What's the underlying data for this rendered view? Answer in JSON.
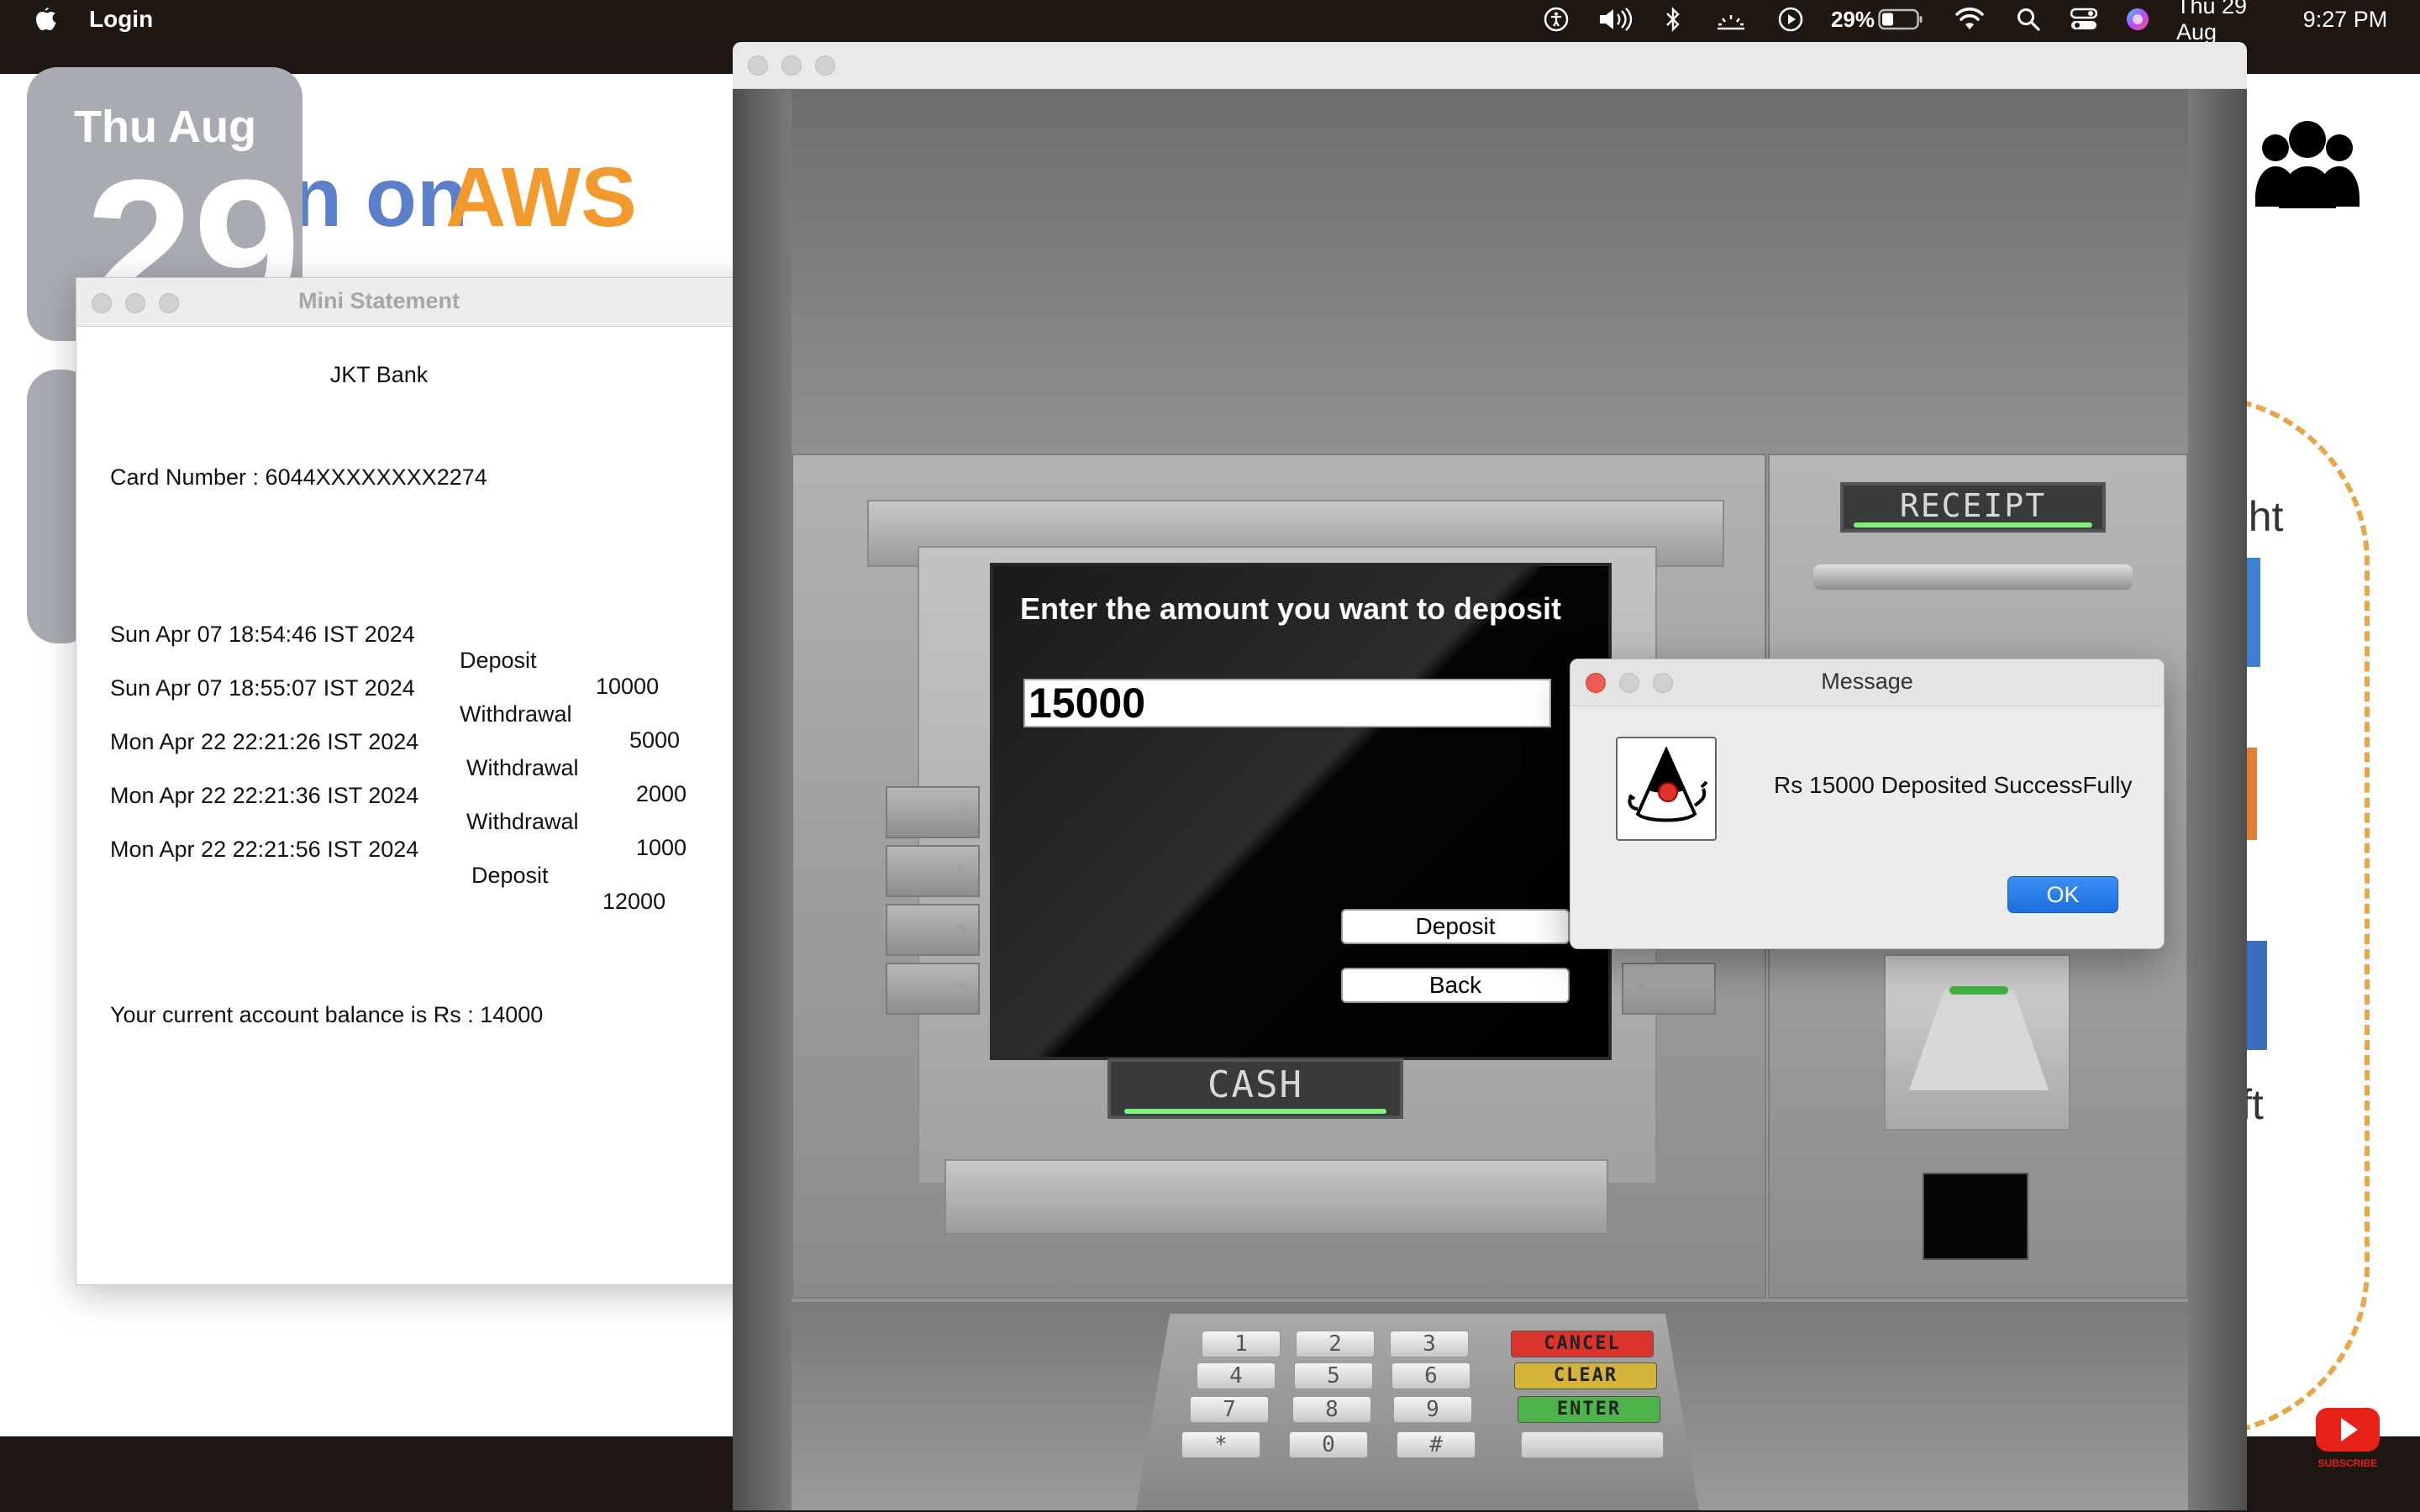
{
  "menubar": {
    "app_name": "Login",
    "battery_percent": "29%",
    "date": "Thu 29 Aug",
    "time": "9:27 PM"
  },
  "desktop": {
    "aws_on": "n on",
    "aws": "AWS",
    "right_text_1": "ght",
    "right_text_2": "ft",
    "calendar_day": "Thu Aug",
    "calendar_num": "29"
  },
  "mini_statement": {
    "title": "Mini Statement",
    "bank": "JKT Bank",
    "card_number": "Card Number : 6044XXXXXXXX2274",
    "transactions": [
      {
        "date": "Sun Apr 07 18:54:46 IST 2024",
        "type": "Deposit",
        "amount": "10000"
      },
      {
        "date": "Sun Apr 07 18:55:07 IST 2024",
        "type": "Withdrawal",
        "amount": "5000"
      },
      {
        "date": "Mon Apr 22 22:21:26 IST 2024",
        "type": "Withdrawal",
        "amount": "2000"
      },
      {
        "date": "Mon Apr 22 22:21:36 IST 2024",
        "type": "Withdrawal",
        "amount": "1000"
      },
      {
        "date": "Mon Apr 22 22:21:56 IST 2024",
        "type": "Deposit",
        "amount": "12000"
      }
    ],
    "balance": "Your current account balance is Rs : 14000"
  },
  "atm": {
    "prompt": "Enter the amount you want to deposit",
    "amount_value": "15000",
    "deposit_label": "Deposit",
    "back_label": "Back",
    "cash_label": "CASH",
    "receipt_label": "RECEIPT",
    "keys": [
      "1",
      "2",
      "3",
      "4",
      "5",
      "6",
      "7",
      "8",
      "9",
      "*",
      "0",
      "#"
    ],
    "cancel_label": "CANCEL",
    "clear_label": "CLEAR",
    "enter_label": "ENTER"
  },
  "dialog": {
    "title": "Message",
    "message": "Rs 15000 Deposited SuccessFully",
    "ok_label": "OK"
  },
  "colors": {
    "accent_blue": "#1c6fe0",
    "aws_orange": "#f29a2e",
    "cancel_red": "#d9332b",
    "clear_yellow": "#d6b43a",
    "enter_green": "#4db34a"
  }
}
